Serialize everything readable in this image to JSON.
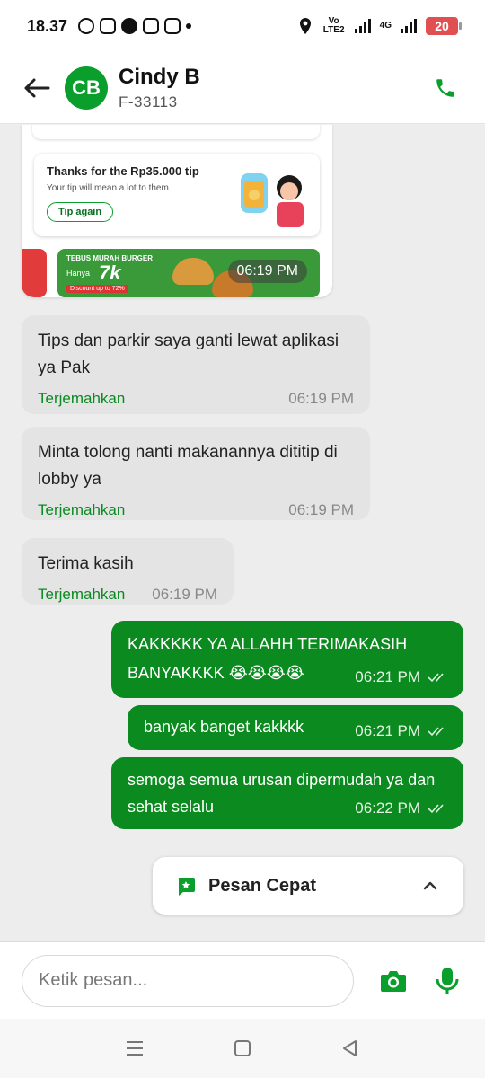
{
  "status_bar": {
    "time": "18.37",
    "network": "4G",
    "lte": "Vo LTE2",
    "battery": "20"
  },
  "header": {
    "avatar_initials": "CB",
    "name": "Cindy B",
    "subtitle": "F-33113",
    "back_icon": "arrow-left-icon",
    "call_icon": "phone-icon"
  },
  "tip_card": {
    "title": "Thanks for the Rp35.000 tip",
    "subtitle": "Your tip will mean a lot to them.",
    "button": "Tip again"
  },
  "promo_banner": {
    "line1": "TEBUS MURAH BURGER",
    "line2": "Hanya",
    "price": "7k",
    "discount": "Discount up to 72%",
    "time": "06:19 PM"
  },
  "messages": [
    {
      "direction": "in",
      "text": "Tips dan parkir saya ganti lewat aplikasi ya Pak",
      "translate": "Terjemahkan",
      "time": "06:19 PM"
    },
    {
      "direction": "in",
      "text": "Minta tolong nanti makanannya dititip di lobby ya",
      "translate": "Terjemahkan",
      "time": "06:19 PM"
    },
    {
      "direction": "in",
      "text": "Terima kasih",
      "translate": "Terjemahkan",
      "time": "06:19 PM"
    },
    {
      "direction": "out",
      "text": "KAKKKKK YA ALLAHH TERIMAKASIH BANYAKKKK 😭😭😭😭",
      "time": "06:21 PM"
    },
    {
      "direction": "out",
      "text": "banyak banget kakkkk",
      "time": "06:21 PM"
    },
    {
      "direction": "out",
      "text": "semoga semua urusan dipermudah ya dan sehat selalu",
      "time": "06:22 PM"
    }
  ],
  "quick_reply": {
    "label": "Pesan Cepat"
  },
  "composer": {
    "placeholder": "Ketik pesan..."
  },
  "colors": {
    "brand_green": "#0a9e2c",
    "outgoing_bubble": "#0b8a1f",
    "incoming_bubble": "#e4e4e4"
  }
}
